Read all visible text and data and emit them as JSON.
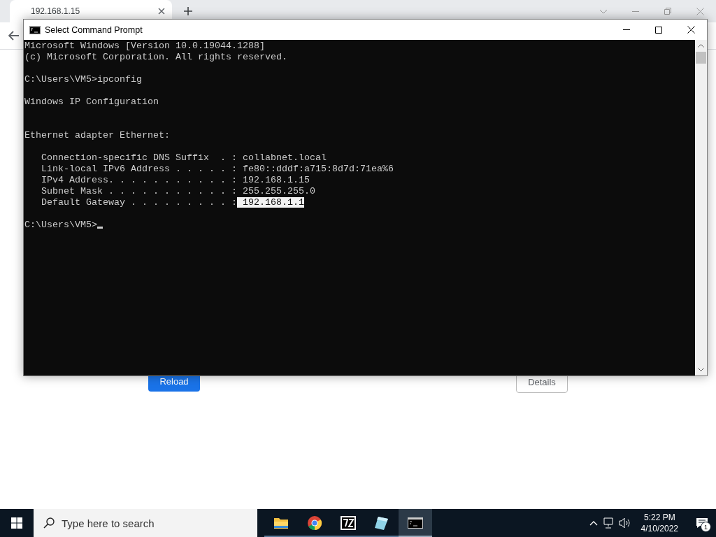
{
  "browser": {
    "tab": {
      "title": "192.168.1.15",
      "selected": true
    },
    "buttons": [
      {
        "label": "Reload",
        "kind": "primary"
      },
      {
        "label": "Details",
        "kind": "secondary"
      }
    ]
  },
  "console_window": {
    "title": "Select Command Prompt",
    "lines": [
      {
        "kind": "text",
        "text": "Microsoft Windows [Version 10.0.19044.1288]"
      },
      {
        "kind": "text",
        "text": "(c) Microsoft Corporation. All rights reserved."
      },
      {
        "kind": "blank"
      },
      {
        "kind": "text",
        "text": "C:\\Users\\VM5>ipconfig"
      },
      {
        "kind": "blank"
      },
      {
        "kind": "text",
        "text": "Windows IP Configuration"
      },
      {
        "kind": "blank"
      },
      {
        "kind": "blank"
      },
      {
        "kind": "text",
        "text": "Ethernet adapter Ethernet:"
      },
      {
        "kind": "blank"
      },
      {
        "kind": "entry",
        "label": "Connection-specific DNS Suffix  . :",
        "value": "collabnet.local",
        "selected": false
      },
      {
        "kind": "entry",
        "label": "Link-local IPv6 Address . . . . . :",
        "value": "fe80::dddf:a715:8d7d:71ea%6",
        "selected": false
      },
      {
        "kind": "entry",
        "label": "IPv4 Address. . . . . . . . . . . :",
        "value": "192.168.1.15",
        "selected": false
      },
      {
        "kind": "entry",
        "label": "Subnet Mask . . . . . . . . . . . :",
        "value": "255.255.255.0",
        "selected": false
      },
      {
        "kind": "entry",
        "label": "Default Gateway . . . . . . . . . :",
        "value": "192.168.1.1",
        "selected": true
      },
      {
        "kind": "blank"
      },
      {
        "kind": "prompt",
        "text": "C:\\Users\\VM5>",
        "cursor": true
      }
    ]
  },
  "taskbar": {
    "search": {
      "placeholder": "Type here to search"
    },
    "apps": [
      {
        "kind": "folder",
        "selected": false
      },
      {
        "kind": "chrome",
        "selected": false
      },
      {
        "kind": "archiver",
        "selected": false
      },
      {
        "kind": "notepad",
        "selected": false
      },
      {
        "kind": "console",
        "selected": true
      }
    ],
    "time": "5:22 PM",
    "date": "4/10/2022",
    "notifications": "1"
  }
}
